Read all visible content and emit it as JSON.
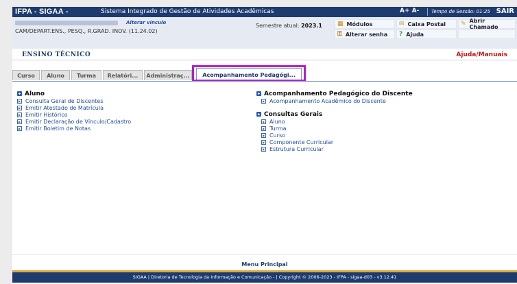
{
  "header": {
    "app_title": "IFPA - SIGAA -",
    "system_name": "Sistema Integrado de Gestão de Atividades Acadêmicas",
    "font_controls": "A+ A-",
    "session_time": "Tempo de Sessão: 01:25",
    "exit_label": "SAIR"
  },
  "user": {
    "change_link": "Alterar vínculo",
    "department": "CAM/DEPART.ENS., PESQ., R.GRAD. INOV. (11.24.02)",
    "semester_label": "Semestre atual:",
    "semester_value": "2023.1"
  },
  "quick_links": [
    {
      "label": "Módulos",
      "icon": "modules-icon",
      "glyph": "▦",
      "color": "#d38a12"
    },
    {
      "label": "Caixa Postal",
      "icon": "mailbox-icon",
      "glyph": "✉",
      "color": "#c49a3a"
    },
    {
      "label": "Abrir Chamado",
      "icon": "ticket-icon",
      "glyph": "✎",
      "color": "#d9a400"
    },
    {
      "label": "Alterar senha",
      "icon": "password-icon",
      "glyph": "⚿",
      "color": "#c97a12"
    },
    {
      "label": "Ajuda",
      "icon": "help-icon",
      "glyph": "?",
      "color": "#3a9a3a"
    }
  ],
  "section": {
    "title": "ENSINO TÉCNICO",
    "help_link": "Ajuda/Manuais"
  },
  "tabs": [
    {
      "label": "Curso"
    },
    {
      "label": "Aluno"
    },
    {
      "label": "Turma"
    },
    {
      "label": "Relatóri..."
    },
    {
      "label": "Administraç..."
    },
    {
      "label": "Acompanhamento Pedagógi..."
    }
  ],
  "groups": {
    "aluno": {
      "title": "Aluno",
      "items": [
        "Consulta Geral de Discentes",
        "Emitir Atestado de Matrícula",
        "Emitir Histórico",
        "Emitir Declaração de Vínculo/Cadastro",
        "Emitir Boletim de Notas"
      ]
    },
    "acompanhamento": {
      "title": "Acompanhamento Pedagógico do Discente",
      "items": [
        "Acompanhamento Acadêmico do Discente"
      ]
    },
    "consultas": {
      "title": "Consultas Gerais",
      "items": [
        "Aluno",
        "Turma",
        "Curso",
        "Componente Curricular",
        "Estrutura Curricular"
      ]
    }
  },
  "menu_principal": "Menu Principal",
  "footer": "SIGAA | Diretoria de Tecnologia da Informação e Comunicação - | Copyright © 2006-2023 - IFPA - sigaa-d03 - v3.12.41"
}
